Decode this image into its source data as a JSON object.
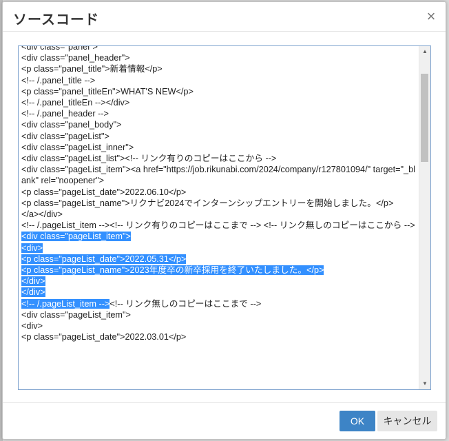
{
  "dialog": {
    "title": "ソースコード",
    "close_glyph": "×",
    "ok_label": "OK",
    "cancel_label": "キャンセル"
  },
  "editor": {
    "lines": [
      {
        "text": "<div class=\"panel\">",
        "selected": false
      },
      {
        "text": "<div class=\"panel_header\">",
        "selected": false
      },
      {
        "text": "<p class=\"panel_title\">新着情報</p>",
        "selected": false
      },
      {
        "text": "<!-- /.panel_title -->",
        "selected": false
      },
      {
        "text": "<p class=\"panel_titleEn\">WHAT'S NEW</p>",
        "selected": false
      },
      {
        "text": "<!-- /.panel_titleEn --></div>",
        "selected": false
      },
      {
        "text": "<!-- /.panel_header -->",
        "selected": false
      },
      {
        "text": "<div class=\"panel_body\">",
        "selected": false
      },
      {
        "text": "<div class=\"pageList\">",
        "selected": false
      },
      {
        "text": "<div class=\"pageList_inner\">",
        "selected": false
      },
      {
        "text": "<div class=\"pageList_list\"><!-- リンク有りのコピーはここから -->",
        "selected": false
      },
      {
        "text": "<div class=\"pageList_item\"><a href=\"https://job.rikunabi.com/2024/company/r127801094/\" target=\"_blank\" rel=\"noopener\">",
        "selected": false
      },
      {
        "text": "<p class=\"pageList_date\">2022.06.10</p>",
        "selected": false
      },
      {
        "text": "<p class=\"pageList_name\">リクナビ2024でインターンシップエントリーを開始しました。</p>",
        "selected": false
      },
      {
        "text": "</a></div>",
        "selected": false
      },
      {
        "text": "<!-- /.pageList_item --><!-- リンク有りのコピーはここまで --> <!-- リンク無しのコピーはここから -->",
        "selected": false
      },
      {
        "text": "<div class=\"pageList_item\">",
        "selected": true
      },
      {
        "text": "<div>",
        "selected": true
      },
      {
        "text": "<p class=\"pageList_date\">2022.05.31</p>",
        "selected": true
      },
      {
        "text": "<p class=\"pageList_name\">2023年度卒の新卒採用を終了いたしました。</p>",
        "selected": true
      },
      {
        "text": "</div>",
        "selected": true
      },
      {
        "text": "</div>",
        "selected": true
      },
      {
        "text": "<!-- /.pageList_item -->",
        "selected": true,
        "tail": "<!-- リンク無しのコピーはここまで -->"
      },
      {
        "text": "<div class=\"pageList_item\">",
        "selected": false
      },
      {
        "text": "<div>",
        "selected": false
      },
      {
        "text": "<p class=\"pageList_date\">2022.03.01</p>",
        "selected": false
      }
    ]
  },
  "scrollbar": {
    "up_glyph": "▲",
    "down_glyph": "▼"
  }
}
